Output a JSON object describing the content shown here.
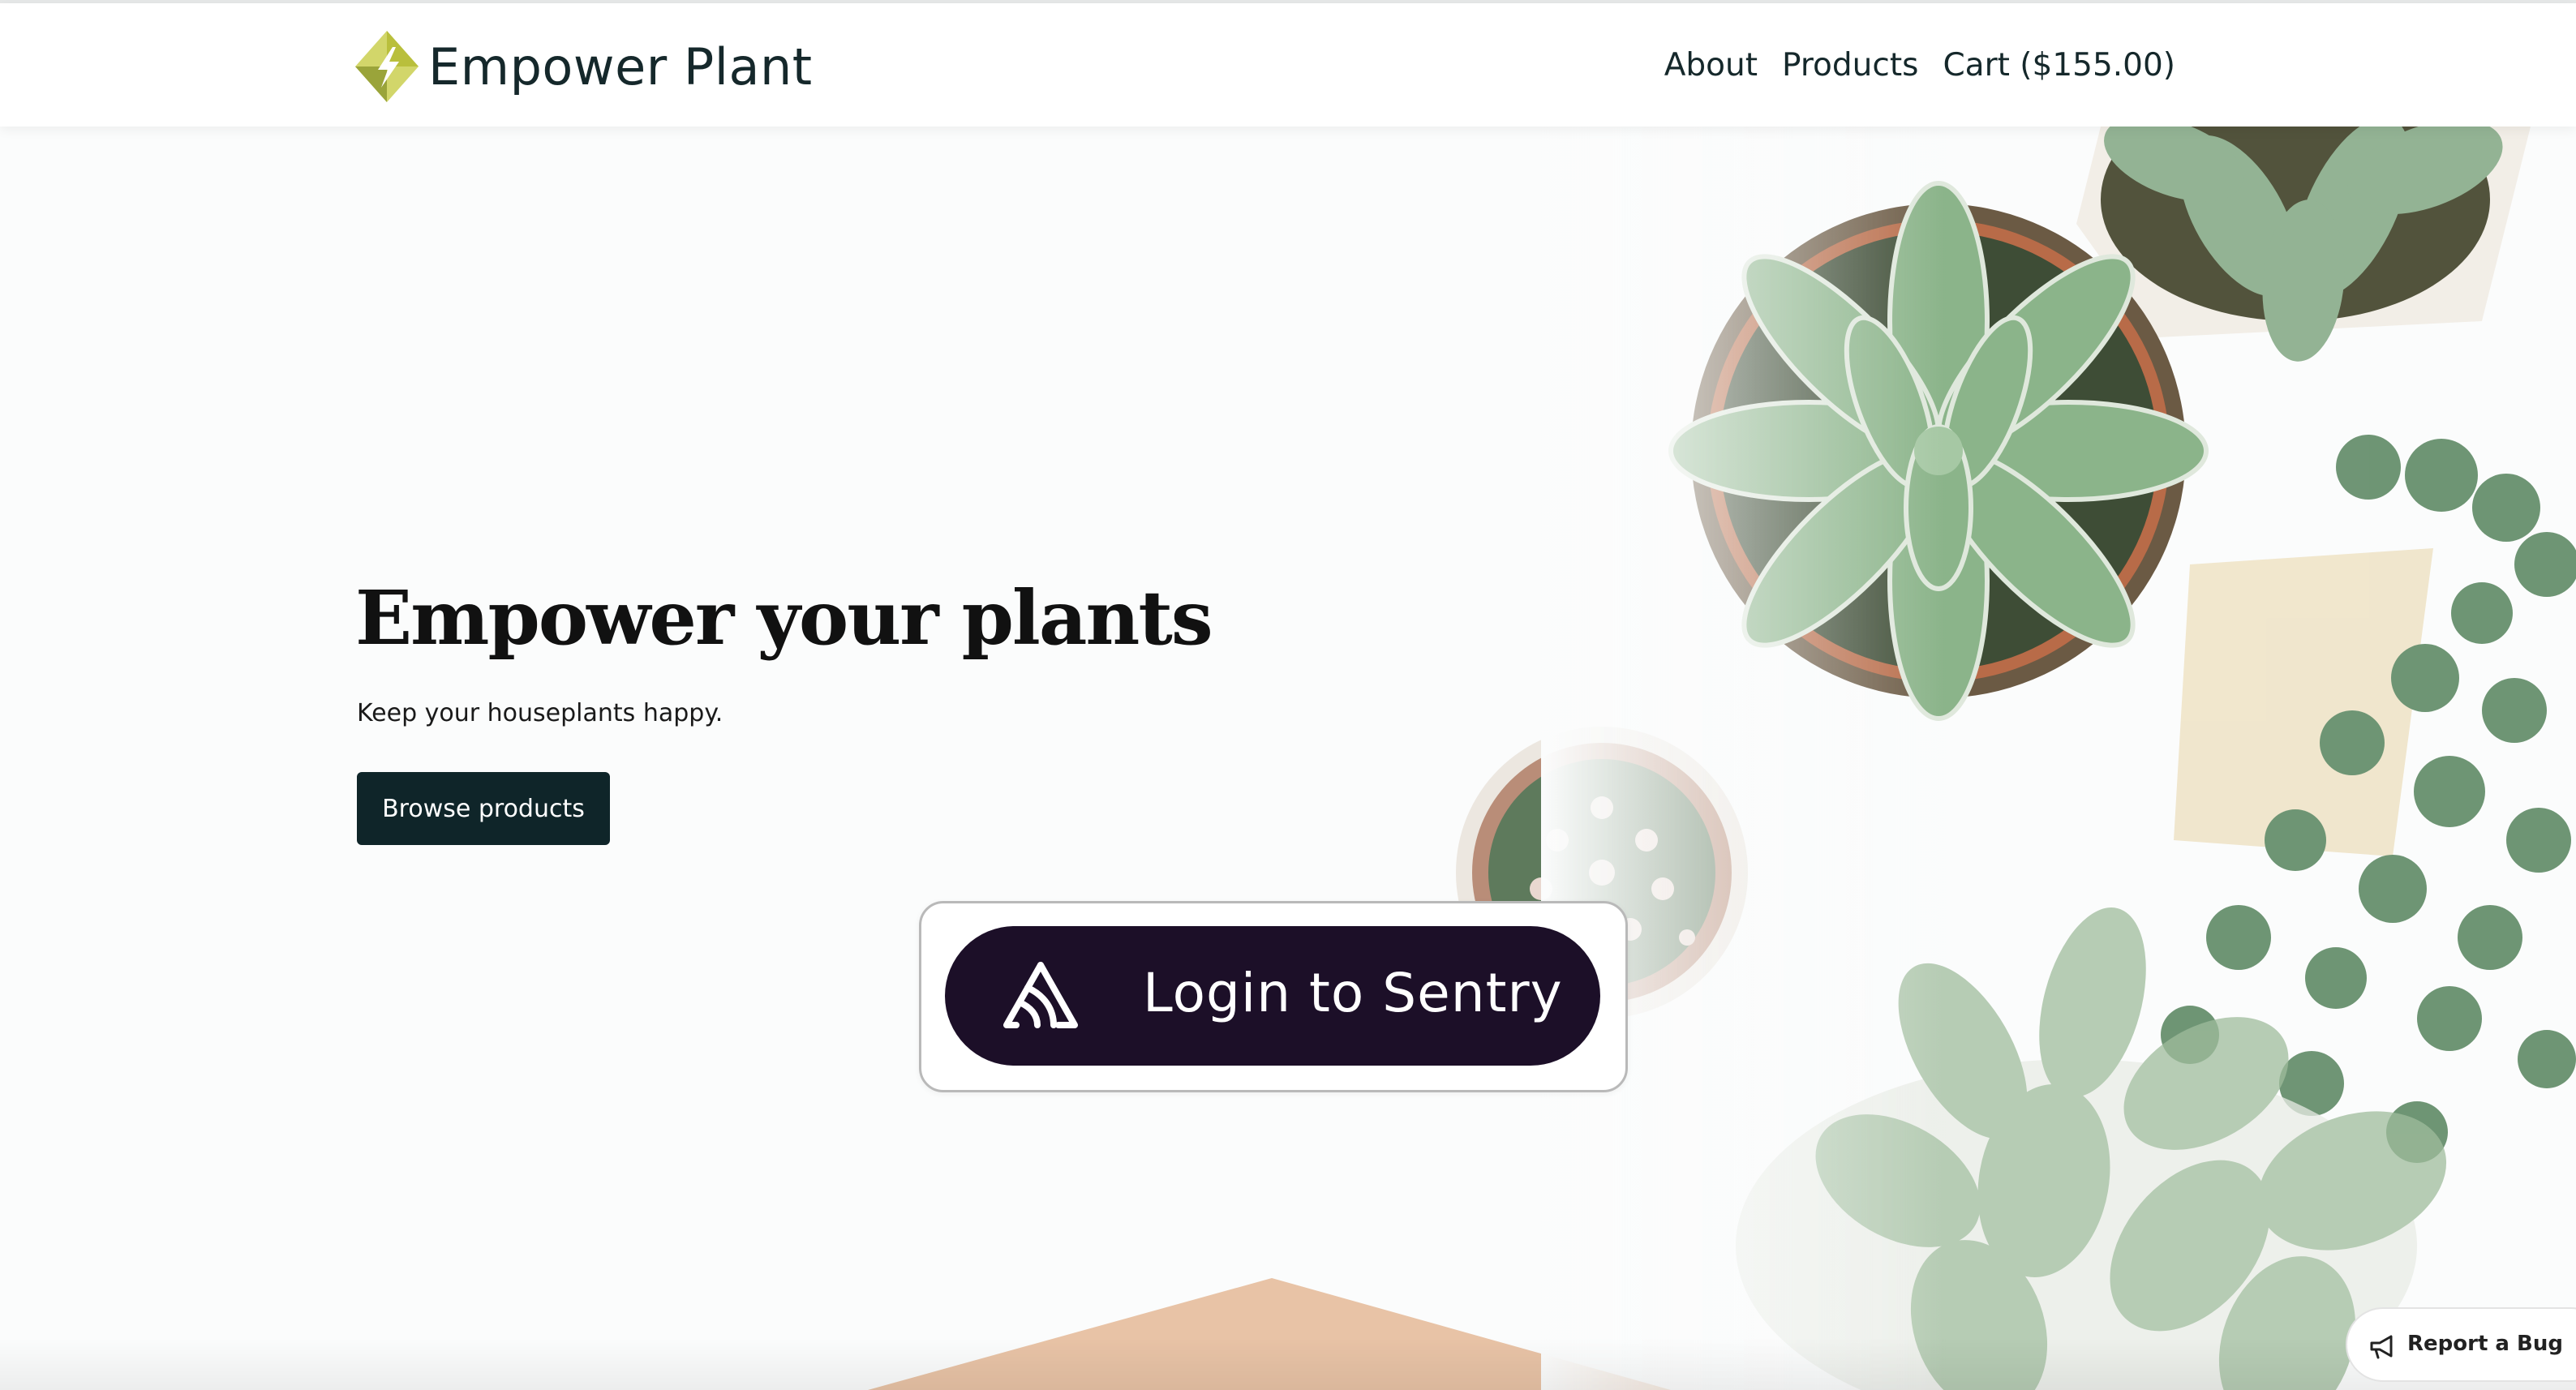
{
  "header": {
    "brand": "Empower Plant",
    "nav": {
      "about": "About",
      "products": "Products",
      "cart": "Cart ($155.00)"
    }
  },
  "hero": {
    "title": "Empower your plants",
    "subtitle": "Keep your houseplants happy.",
    "browse_label": "Browse products"
  },
  "overlay": {
    "login_label": "Login to Sentry"
  },
  "report": {
    "label": "Report a Bug"
  },
  "colors": {
    "header_text": "#15282b",
    "button_dark": "#0f2529",
    "login_bg": "#1c0f28",
    "accent_peach": "#e8c3a6",
    "leaf_green": "#7aa37f",
    "logo_yellow": "#d4d75c"
  },
  "icons": {
    "logo": "lightning-diamond-icon",
    "login": "sentry-logo-icon",
    "report": "megaphone-icon"
  }
}
